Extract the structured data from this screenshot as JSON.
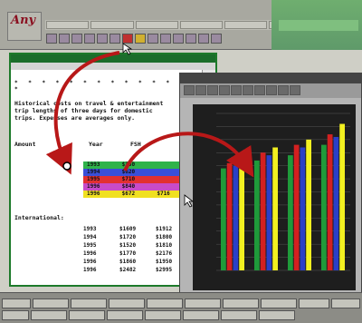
{
  "logo": {
    "text": "Any"
  },
  "doc_window": {
    "paragraph": "Historical costs on travel & entertainment\ntrip lengths of three days for domestic\ntrips. Expenses are averages only.",
    "column_headers": [
      "Amount",
      "Year",
      "FSH"
    ],
    "colored_rows": [
      {
        "color": "#2fb34a",
        "cells": [
          "1993",
          "$350",
          ""
        ]
      },
      {
        "color": "#3a4fd8",
        "cells": [
          "1994",
          "$620",
          ""
        ]
      },
      {
        "color": "#e23030",
        "cells": [
          "1995",
          "$710",
          ""
        ]
      },
      {
        "color": "#c84bc8",
        "cells": [
          "1996",
          "$840",
          ""
        ]
      },
      {
        "color": "#f0e020",
        "cells": [
          "1996",
          "$672",
          "$716"
        ]
      }
    ],
    "international_label": "International:",
    "intl_rows": [
      [
        "1993",
        "$1609",
        "$1912"
      ],
      [
        "1994",
        "$1720",
        "$1800"
      ],
      [
        "1995",
        "$1520",
        "$1810"
      ],
      [
        "1996",
        "$1770",
        "$2176"
      ],
      [
        "1996",
        "$1860",
        "$1950"
      ],
      [
        "1996",
        "$2482",
        "$2995"
      ]
    ]
  },
  "chart_data": {
    "type": "bar",
    "categories": [
      "",
      "",
      "",
      ""
    ],
    "series": [
      {
        "values": [
          78,
          84,
          88,
          96
        ],
        "color": "#1f9a3a"
      },
      {
        "values": [
          82,
          90,
          96,
          104
        ],
        "color": "#d32020"
      },
      {
        "values": [
          80,
          88,
          94,
          102
        ],
        "color": "#2a3fc8"
      },
      {
        "values": [
          86,
          94,
          100,
          112
        ],
        "color": "#f2f020"
      }
    ],
    "ylim": [
      0,
      120
    ],
    "grid": true
  },
  "colors": {
    "doc_border": "#1d7a2a",
    "arrow": "#b81818"
  }
}
